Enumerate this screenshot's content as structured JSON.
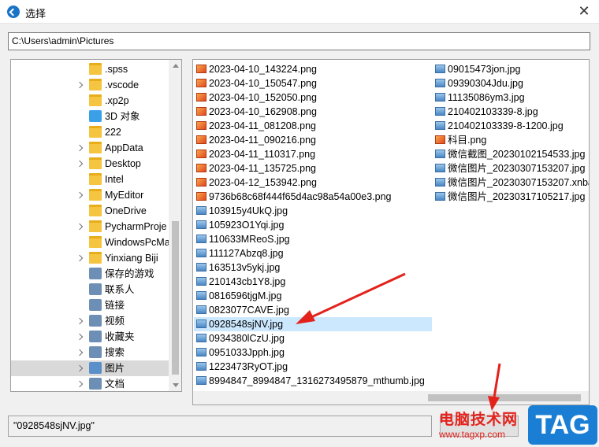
{
  "window": {
    "title": "选择",
    "close_symbol": "✕"
  },
  "path": {
    "value": "C:\\Users\\admin\\Pictures"
  },
  "tree": {
    "items": [
      {
        "label": ".spss",
        "icon": "folder-icon",
        "chevron": false
      },
      {
        "label": ".vscode",
        "icon": "folder-icon",
        "chevron": true
      },
      {
        "label": ".xp2p",
        "icon": "folder-icon",
        "chevron": false
      },
      {
        "label": "3D 对象",
        "icon": "cube-3d-icon",
        "chevron": false
      },
      {
        "label": "222",
        "icon": "folder-icon",
        "chevron": false
      },
      {
        "label": "AppData",
        "icon": "folder-icon",
        "chevron": true
      },
      {
        "label": "Desktop",
        "icon": "folder-icon",
        "chevron": true
      },
      {
        "label": "Intel",
        "icon": "folder-icon",
        "chevron": false
      },
      {
        "label": "MyEditor",
        "icon": "folder-icon",
        "chevron": true
      },
      {
        "label": "OneDrive",
        "icon": "folder-icon",
        "chevron": false
      },
      {
        "label": "PycharmProje",
        "icon": "folder-icon",
        "chevron": true
      },
      {
        "label": "WindowsPcMa",
        "icon": "folder-icon",
        "chevron": false
      },
      {
        "label": "Yinxiang Biji",
        "icon": "folder-icon",
        "chevron": true
      },
      {
        "label": "保存的游戏",
        "icon": "saved-games-icon",
        "chevron": false
      },
      {
        "label": "联系人",
        "icon": "contacts-icon",
        "chevron": false
      },
      {
        "label": "链接",
        "icon": "links-icon",
        "chevron": false
      },
      {
        "label": "视频",
        "icon": "videos-icon",
        "chevron": true
      },
      {
        "label": "收藏夹",
        "icon": "favorites-icon",
        "chevron": true
      },
      {
        "label": "搜索",
        "icon": "search-icon",
        "chevron": true
      },
      {
        "label": "图片",
        "icon": "pictures-icon",
        "chevron": true,
        "selected": true
      },
      {
        "label": "文档",
        "icon": "documents-icon",
        "chevron": true
      }
    ]
  },
  "files": {
    "col1": [
      {
        "name": "2023-04-10_143224.png",
        "type": "png"
      },
      {
        "name": "2023-04-10_150547.png",
        "type": "png"
      },
      {
        "name": "2023-04-10_152050.png",
        "type": "png"
      },
      {
        "name": "2023-04-10_162908.png",
        "type": "png"
      },
      {
        "name": "2023-04-11_081208.png",
        "type": "png"
      },
      {
        "name": "2023-04-11_090216.png",
        "type": "png"
      },
      {
        "name": "2023-04-11_110317.png",
        "type": "png"
      },
      {
        "name": "2023-04-11_135725.png",
        "type": "png"
      },
      {
        "name": "2023-04-12_153942.png",
        "type": "png"
      },
      {
        "name": "9736b68c68f444f65d4ac98a54a00e3.png",
        "type": "png"
      },
      {
        "name": "103915y4UkQ.jpg",
        "type": "jpg"
      },
      {
        "name": "105923O1Yqi.jpg",
        "type": "jpg"
      },
      {
        "name": "110633MReoS.jpg",
        "type": "jpg"
      },
      {
        "name": "111127Abzq8.jpg",
        "type": "jpg"
      },
      {
        "name": "163513v5ykj.jpg",
        "type": "jpg"
      },
      {
        "name": "210143cb1Y8.jpg",
        "type": "jpg"
      },
      {
        "name": "0816596tjgM.jpg",
        "type": "jpg"
      },
      {
        "name": "0823077CAVE.jpg",
        "type": "jpg"
      },
      {
        "name": "0928548sjNV.jpg",
        "type": "jpg",
        "selected": true
      },
      {
        "name": "0934380lCzU.jpg",
        "type": "jpg"
      },
      {
        "name": "0951033Jpph.jpg",
        "type": "jpg"
      },
      {
        "name": "1223473RyOT.jpg",
        "type": "jpg"
      },
      {
        "name": "8994847_8994847_1316273495879_mthumb.jpg",
        "type": "jpg"
      }
    ],
    "col2": [
      {
        "name": "09015473jon.jpg",
        "type": "jpg"
      },
      {
        "name": "09390304Jdu.jpg",
        "type": "jpg"
      },
      {
        "name": "11135086ym3.jpg",
        "type": "jpg"
      },
      {
        "name": "210402103339-8.jpg",
        "type": "jpg"
      },
      {
        "name": "210402103339-8-1200.jpg",
        "type": "jpg"
      },
      {
        "name": "科目.png",
        "type": "png"
      },
      {
        "name": "微信截图_20230102154533.jpg",
        "type": "jpg"
      },
      {
        "name": "微信图片_20230307153207.jpg",
        "type": "jpg"
      },
      {
        "name": "微信图片_20230307153207.xnbak",
        "type": "jpg"
      },
      {
        "name": "微信图片_20230317105217.jpg",
        "type": "jpg"
      }
    ]
  },
  "selection": {
    "value": "\"0928548sjNV.jpg\""
  },
  "watermark": {
    "cn_text": "电脑技术网",
    "url": "www.tagxp.com",
    "tag": "TAG"
  },
  "colors": {
    "selected_file": "#cce8ff",
    "annotation_arrow": "#e3221c",
    "tag_badge": "#1a7fd4"
  }
}
